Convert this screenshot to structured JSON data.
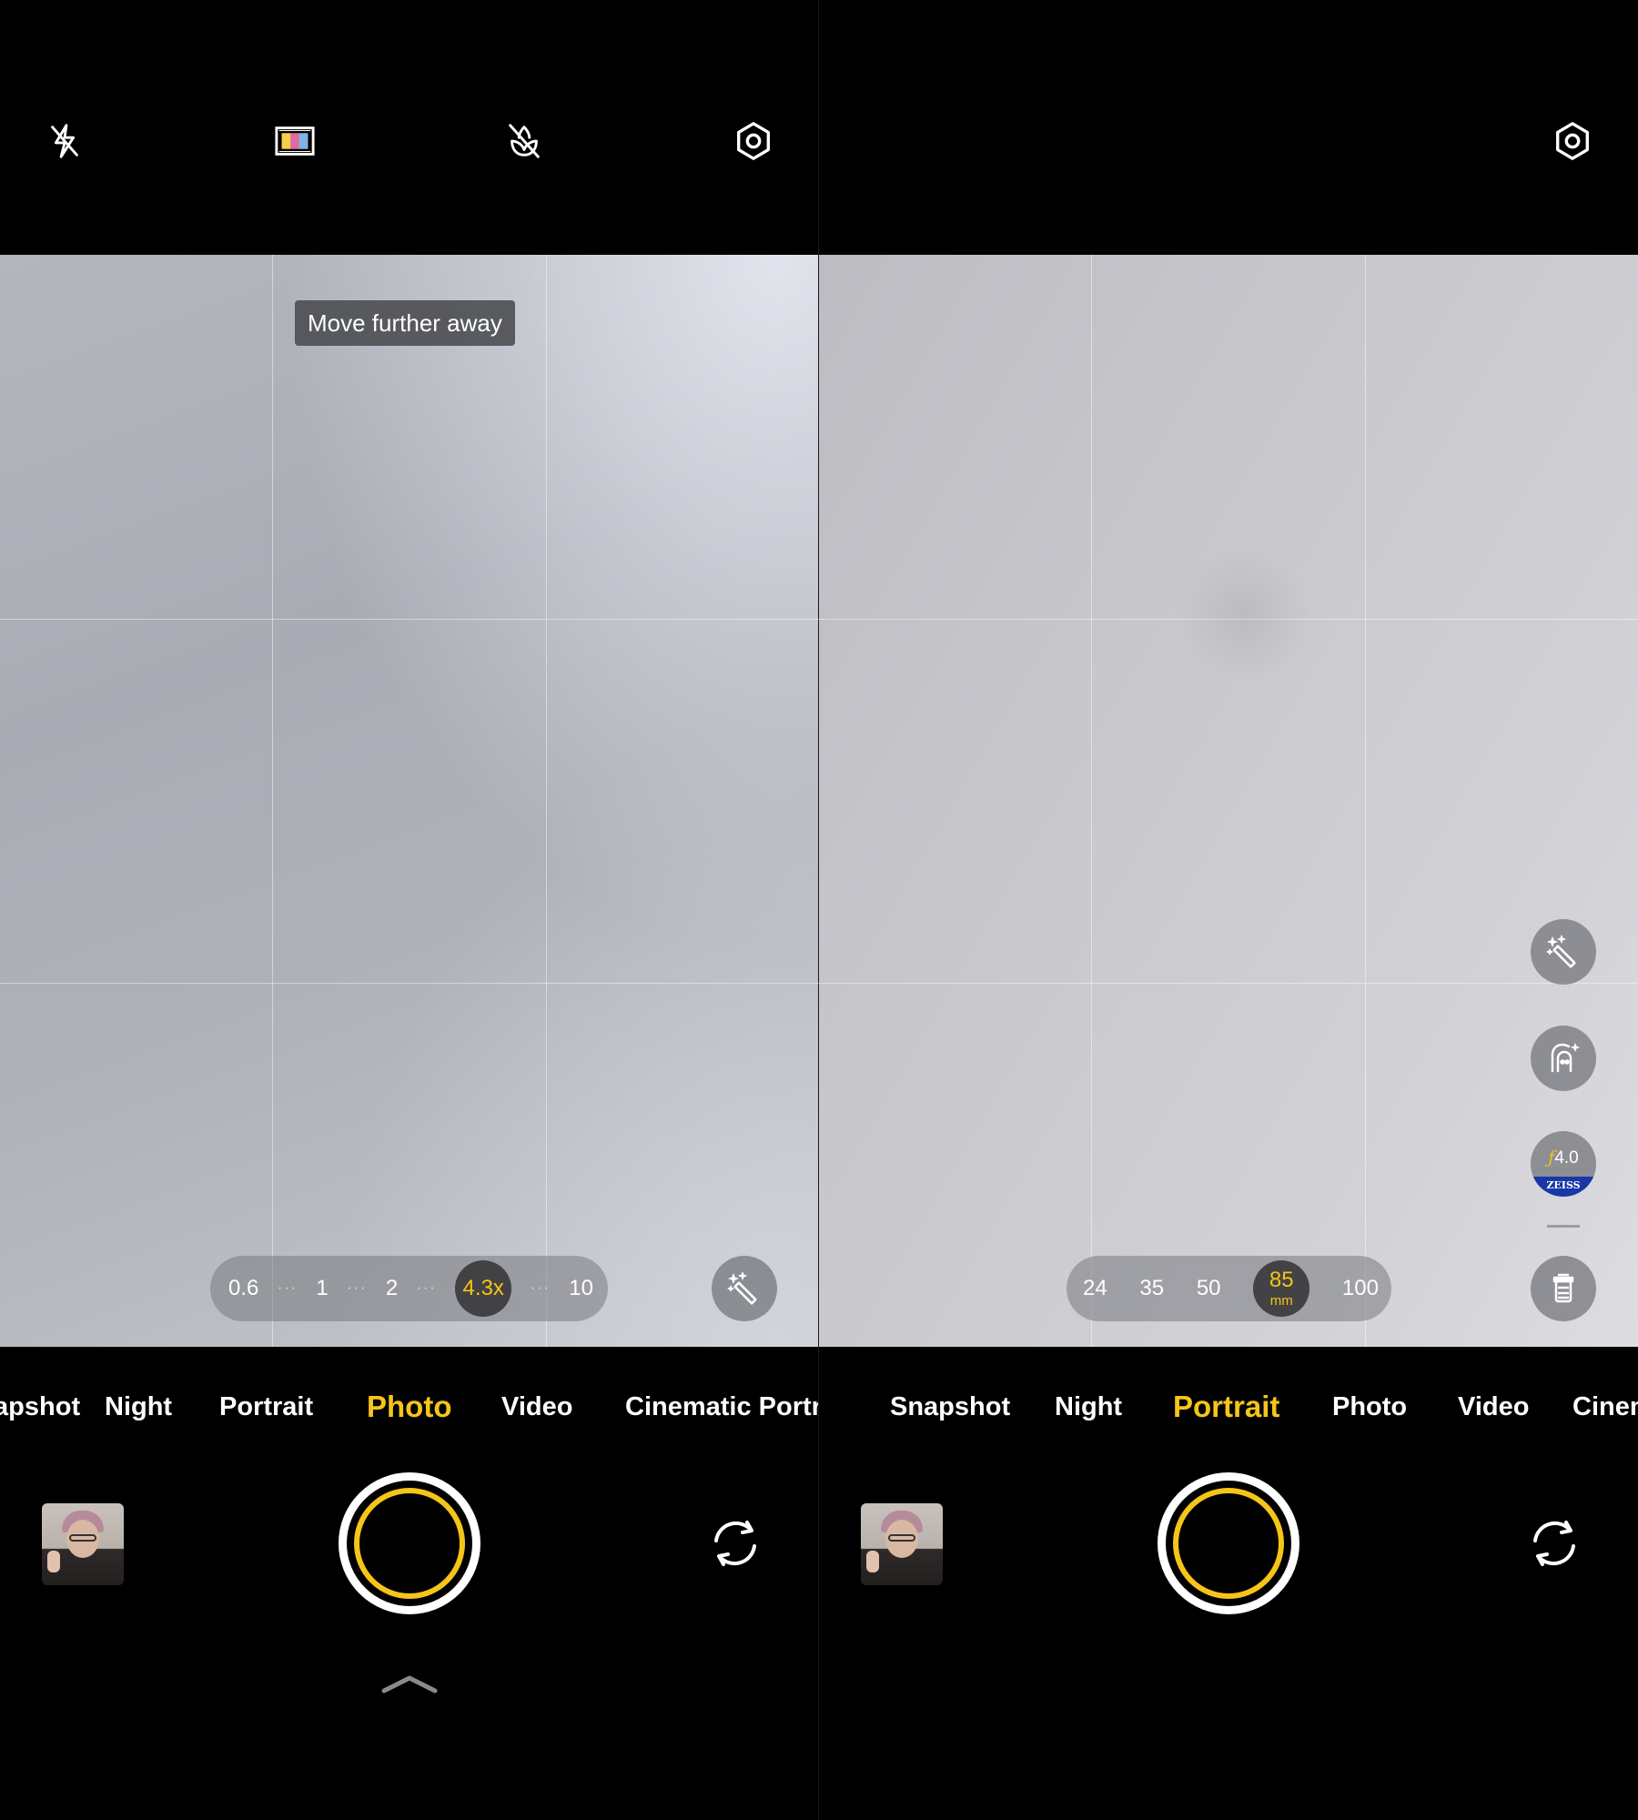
{
  "colors": {
    "accent": "#f5c518",
    "background": "#000000"
  },
  "left": {
    "top_icons": [
      "flash-off-icon",
      "color-filter-icon",
      "macro-off-icon",
      "settings-icon"
    ],
    "toast": "Move further away",
    "zoom": {
      "levels": [
        "0.6",
        "1",
        "2",
        "4.3x",
        "10"
      ],
      "active_index": 3,
      "dots": "···"
    },
    "ai_enhance_icon": "magic-wand-icon",
    "modes": [
      "Snapshot",
      "Night",
      "Portrait",
      "Photo",
      "Video",
      "Cinematic Portrait"
    ],
    "active_mode": "Photo",
    "gallery_icon": "gallery-thumbnail",
    "shutter_icon": "shutter-button",
    "switch_icon": "switch-camera-icon",
    "more_icon": "chevron-up-icon"
  },
  "right": {
    "top_icons": [
      "settings-icon"
    ],
    "focal_lengths": {
      "levels": [
        "24",
        "35",
        "50",
        "85",
        "100"
      ],
      "active_index": 3,
      "unit": "mm"
    },
    "side_buttons": [
      "magic-wand-icon",
      "portrait-beauty-icon",
      "aperture-zeiss-icon",
      "bokeh-style-icon"
    ],
    "aperture": {
      "f_symbol": "ƒ",
      "value": "4.0",
      "brand": "ZEISS"
    },
    "modes": [
      "Snapshot",
      "Night",
      "Portrait",
      "Photo",
      "Video",
      "Cinematic"
    ],
    "active_mode": "Portrait",
    "gallery_icon": "gallery-thumbnail",
    "shutter_icon": "shutter-button",
    "switch_icon": "switch-camera-icon"
  }
}
